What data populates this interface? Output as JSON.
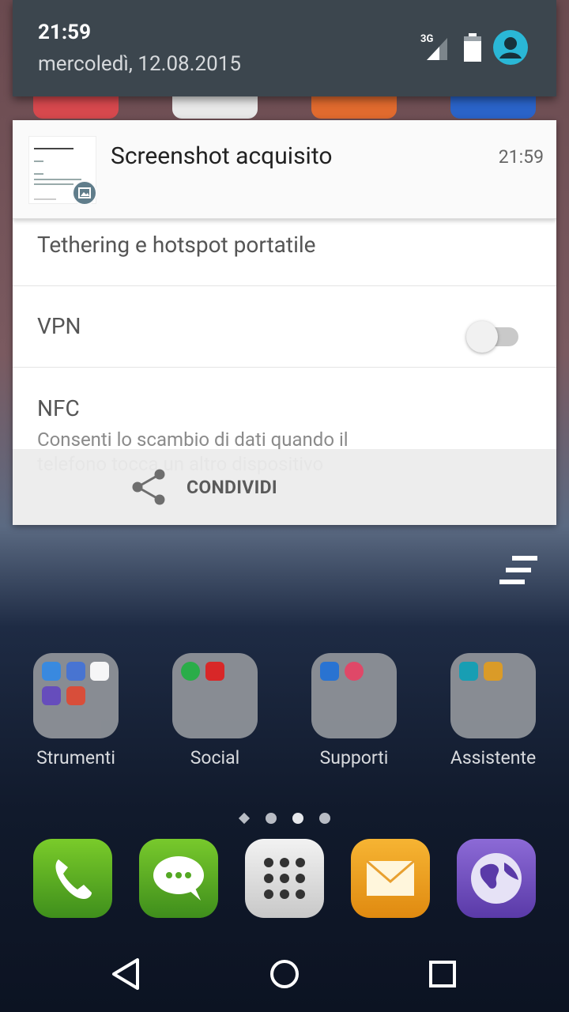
{
  "status": {
    "time": "21:59",
    "date": "mercoledì, 12.08.2015",
    "network": "3G"
  },
  "notification": {
    "title": "Screenshot acquisito",
    "time": "21:59",
    "action_label": "CONDIVIDI"
  },
  "settings_list": {
    "items": [
      {
        "label": "Tethering e hotspot portatile"
      },
      {
        "label": "VPN"
      },
      {
        "label": "NFC",
        "subtitle": "Consenti lo scambio di dati quando il telefono tocca un altro dispositivo",
        "toggle": "off"
      }
    ]
  },
  "home": {
    "folders": [
      {
        "label": "Strumenti"
      },
      {
        "label": "Social"
      },
      {
        "label": "Supporti"
      },
      {
        "label": "Assistente"
      }
    ],
    "dock": [
      "phone-icon",
      "messages-icon",
      "apps-drawer-icon",
      "email-icon",
      "browser-icon"
    ],
    "pages": 4,
    "current_page": 2
  },
  "navbar": [
    "back-icon",
    "home-icon",
    "recents-icon"
  ],
  "colors": {
    "shade_header": "#3c464e",
    "avatar": "#2ab7d6",
    "card": "#ffffff",
    "action_bar": "#ececec"
  }
}
